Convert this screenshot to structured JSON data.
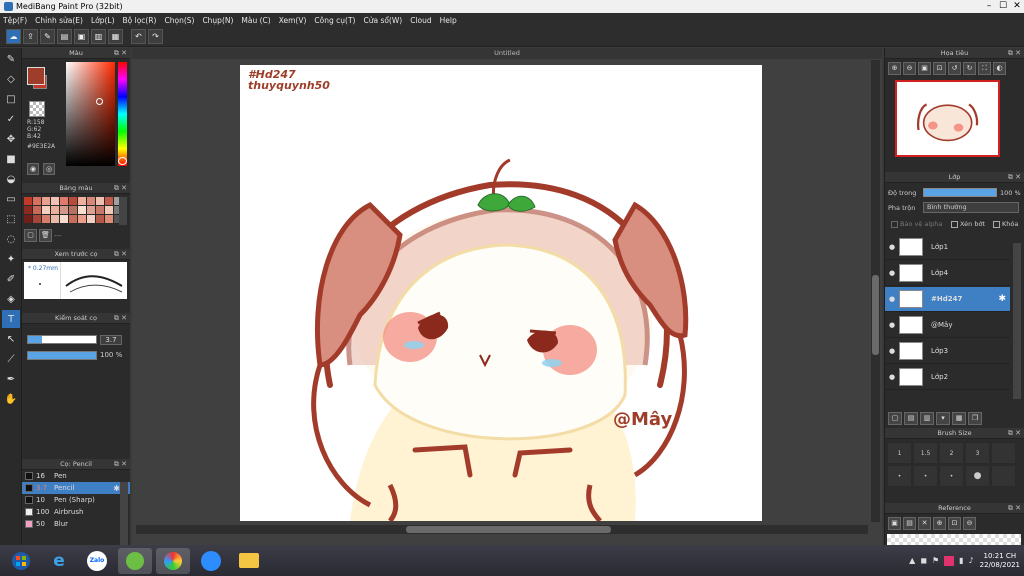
{
  "app": {
    "title": "MediBang Paint Pro (32bit)",
    "window_controls": [
      "–",
      "☐",
      "✕"
    ]
  },
  "menu": [
    "Tệp(F)",
    "Chỉnh sửa(E)",
    "Lớp(L)",
    "Bộ lọc(R)",
    "Chọn(S)",
    "Chụp(N)",
    "Màu (C)",
    "Xem(V)",
    "Công cụ(T)",
    "Cửa sổ(W)",
    "Cloud",
    "Help"
  ],
  "color_panel": {
    "title": "Màu",
    "rgb": [
      "R:158",
      "G:62",
      "B:42"
    ],
    "hex": "#9E3E2A",
    "main_color": "#9e3e2a"
  },
  "palette_panel": {
    "title": "Bảng màu",
    "colors": [
      "#c0392b",
      "#d9705c",
      "#e8a08f",
      "#f2c3b5",
      "#e07a6a",
      "#b84c3a",
      "#f0b0a0",
      "#d88878",
      "#eec0b0",
      "#c45a4a",
      "#a0a0a0",
      "#8b2c22",
      "#cc6655",
      "#f5d0c0",
      "#e9b09a",
      "#d4968a",
      "#b87060",
      "#f8e0d0",
      "#e0a090",
      "#c87868",
      "#f4c8b8",
      "#777777",
      "#6e2018",
      "#a94438",
      "#d77e6a",
      "#eab8a6",
      "#f6dccf",
      "#c96c58",
      "#e99e8a",
      "#f2d0c2",
      "#b45a48",
      "#de8c78",
      "#555555"
    ],
    "ellipsis": "---"
  },
  "preview_panel": {
    "title": "Xem trước cọ",
    "size": "* 0.27mm"
  },
  "control_panel": {
    "title": "Kiểm soát cọ",
    "size_value": "3.7",
    "opacity_value": "100 %",
    "size_fraction": 0.2,
    "opacity_fraction": 1.0
  },
  "brush_panel": {
    "title": "Cọ: Pencil",
    "brushes": [
      {
        "size": "16",
        "name": "Pen",
        "color": "#111111"
      },
      {
        "size": "3.7",
        "name": "Pencil",
        "color": "#111111"
      },
      {
        "size": "10",
        "name": "Pen (Sharp)",
        "color": "#111111"
      },
      {
        "size": "100",
        "name": "Airbrush",
        "color": "#eeeeee"
      },
      {
        "size": "50",
        "name": "Blur",
        "color": "#f0a0c0"
      }
    ]
  },
  "document": {
    "tab": "Untitled",
    "hashtag": "#Hd247",
    "author": "thuyquynh50",
    "signature": "@Mây"
  },
  "navigator": {
    "title": "Họa tiêu"
  },
  "layer_panel": {
    "title": "Lớp",
    "opacity_label": "Độ trong",
    "opacity_value": "100 %",
    "blend_label": "Pha trộn",
    "blend_value": "Bình thường",
    "checkboxes": [
      "Bảo vệ alpha",
      "Xén bớt",
      "Khóa"
    ],
    "layers": [
      {
        "name": "Lớp1",
        "selected": false
      },
      {
        "name": "Lớp4",
        "selected": false
      },
      {
        "name": "#Hd247",
        "selected": true
      },
      {
        "name": "@Mây",
        "selected": false
      },
      {
        "name": "Lớp3",
        "selected": false
      },
      {
        "name": "Lớp2",
        "selected": false
      }
    ]
  },
  "brushsize_panel": {
    "title": "Brush Size",
    "sizes": [
      "1",
      "1.5",
      "2",
      "3",
      ""
    ]
  },
  "reference_panel": {
    "title": "Reference"
  },
  "taskbar": {
    "clock_time": "10:21 CH",
    "clock_date": "22/08/2021",
    "zalo_label": "Zalo"
  }
}
